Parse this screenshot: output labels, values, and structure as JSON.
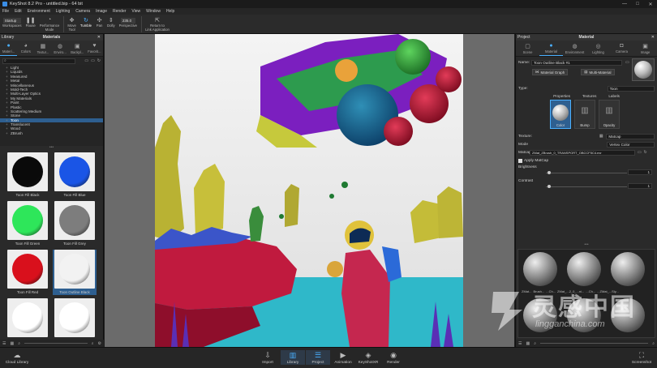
{
  "window": {
    "title": "KeyShot 8.2 Pro  -  untitled.bip  -  64 bit",
    "controls": [
      "—",
      "□",
      "✕"
    ]
  },
  "menu": [
    "File",
    "Edit",
    "Environment",
    "Lighting",
    "Camera",
    "Image",
    "Render",
    "View",
    "Window",
    "Help"
  ],
  "toolbar": {
    "startup": "Startup",
    "workspaces": "Workspaces",
    "pause": "Pause",
    "performance": "Performance\nMode",
    "move_tool": "Move\nTool",
    "tumble": "Tumble",
    "pan": "Pan",
    "dolly": "Dolly",
    "zoom_value": "235.0",
    "perspective": "Perspective",
    "return": "Return to\nLink Application"
  },
  "library": {
    "panel_title": "Library",
    "section_title": "Materials",
    "tabs": [
      {
        "label": "Materi...",
        "icon": "sphere-icon",
        "active": true
      },
      {
        "label": "Colors",
        "icon": "palette-icon",
        "active": false
      },
      {
        "label": "Textur...",
        "icon": "grid-icon",
        "active": false
      },
      {
        "label": "Enviro...",
        "icon": "globe-icon",
        "active": false
      },
      {
        "label": "Backpl...",
        "icon": "image-icon",
        "active": false
      },
      {
        "label": "Favorit...",
        "icon": "heart-icon",
        "active": false
      }
    ],
    "tree": [
      {
        "label": "Light",
        "sel": false
      },
      {
        "label": "Liquids",
        "sel": false
      },
      {
        "label": "Measured",
        "sel": false
      },
      {
        "label": "Metal",
        "sel": false
      },
      {
        "label": "Miscellaneous",
        "sel": false
      },
      {
        "label": "Mold-Tech",
        "sel": false
      },
      {
        "label": "Multi-Layer Optics",
        "sel": false
      },
      {
        "label": "My Materials",
        "sel": false
      },
      {
        "label": "Paint",
        "sel": false
      },
      {
        "label": "Plastic",
        "sel": false
      },
      {
        "label": "Scattering Medium",
        "sel": false
      },
      {
        "label": "Stone",
        "sel": false
      },
      {
        "label": "Toon",
        "sel": true
      },
      {
        "label": "Translucent",
        "sel": false
      },
      {
        "label": "Wood",
        "sel": false
      },
      {
        "label": "ZBrush",
        "sel": false
      }
    ],
    "thumbs": [
      {
        "label": "Toon Fill Black",
        "color": "#0a0a0a",
        "sel": false
      },
      {
        "label": "Toon Fill Blue",
        "color": "#1a55e6",
        "sel": false
      },
      {
        "label": "Toon Fill Green",
        "color": "#2ee65a",
        "sel": false
      },
      {
        "label": "Toon Fill Grey",
        "color": "#7d7d7d",
        "sel": false
      },
      {
        "label": "Toon Fill Red",
        "color": "#d9101c",
        "sel": false
      },
      {
        "label": "Toon Outline Black",
        "color": "#f2f2f2",
        "sel": true
      },
      {
        "label": "",
        "color": "#ffffff",
        "sel": false
      },
      {
        "label": "",
        "color": "#ffffff",
        "sel": false
      }
    ]
  },
  "project": {
    "panel_title": "Project",
    "section_title": "Material",
    "tabs": [
      {
        "label": "Scene",
        "icon": "cube-icon",
        "active": false
      },
      {
        "label": "Material",
        "icon": "sphere-icon",
        "active": true
      },
      {
        "label": "Environment",
        "icon": "globe-icon",
        "active": false
      },
      {
        "label": "Lighting",
        "icon": "bulb-icon",
        "active": false
      },
      {
        "label": "Camera",
        "icon": "camera-icon",
        "active": false
      },
      {
        "label": "Image",
        "icon": "image-icon",
        "active": false
      }
    ],
    "name_label": "Name:",
    "name_value": "Toon Outline Black #1",
    "material_graph": "Material Graph",
    "multi_material": "Multi-Material",
    "type_label": "Type:",
    "type_value": "Toon",
    "subtabs": [
      "Properties",
      "Textures",
      "Labels"
    ],
    "channels": [
      {
        "label": "Color",
        "sel": true
      },
      {
        "label": "Bump",
        "sel": false
      },
      {
        "label": "Opacity",
        "sel": false
      }
    ],
    "texture_label": "Texture:",
    "texture_value": "Matcap",
    "mode_label": "Mode",
    "mode_value": "Vertex Color",
    "matcap_label": "Matcap",
    "matcap_value": "ZMat_ZBrush_0_TRANSPORT_OBCCF5C4.exr",
    "apply_matcap": "Apply MatCap",
    "brightness_label": "Brightness",
    "brightness_value": "1",
    "contrast_label": "Contrast",
    "contrast_value": "1",
    "grid_labels": [
      "ZMat...",
      "Brush...",
      "...Ch...",
      "ZMat_...2_0_...ni...",
      "...Ch...",
      "...ZMat_...Sly..."
    ]
  },
  "bottom": {
    "cloud_library": "Cloud Library",
    "items": [
      {
        "label": "Import",
        "icon": "import-icon",
        "active": false
      },
      {
        "label": "Library",
        "icon": "book-icon",
        "active": true
      },
      {
        "label": "Project",
        "icon": "list-icon",
        "active": true
      },
      {
        "label": "Animation",
        "icon": "play-icon",
        "active": false
      },
      {
        "label": "KeyShotXR",
        "icon": "cube-icon",
        "active": false
      },
      {
        "label": "Render",
        "icon": "teapot-icon",
        "active": false
      }
    ],
    "screenshot": "Screenshot"
  },
  "watermark": {
    "title": "灵感中国",
    "url": "lingganchina.com"
  }
}
